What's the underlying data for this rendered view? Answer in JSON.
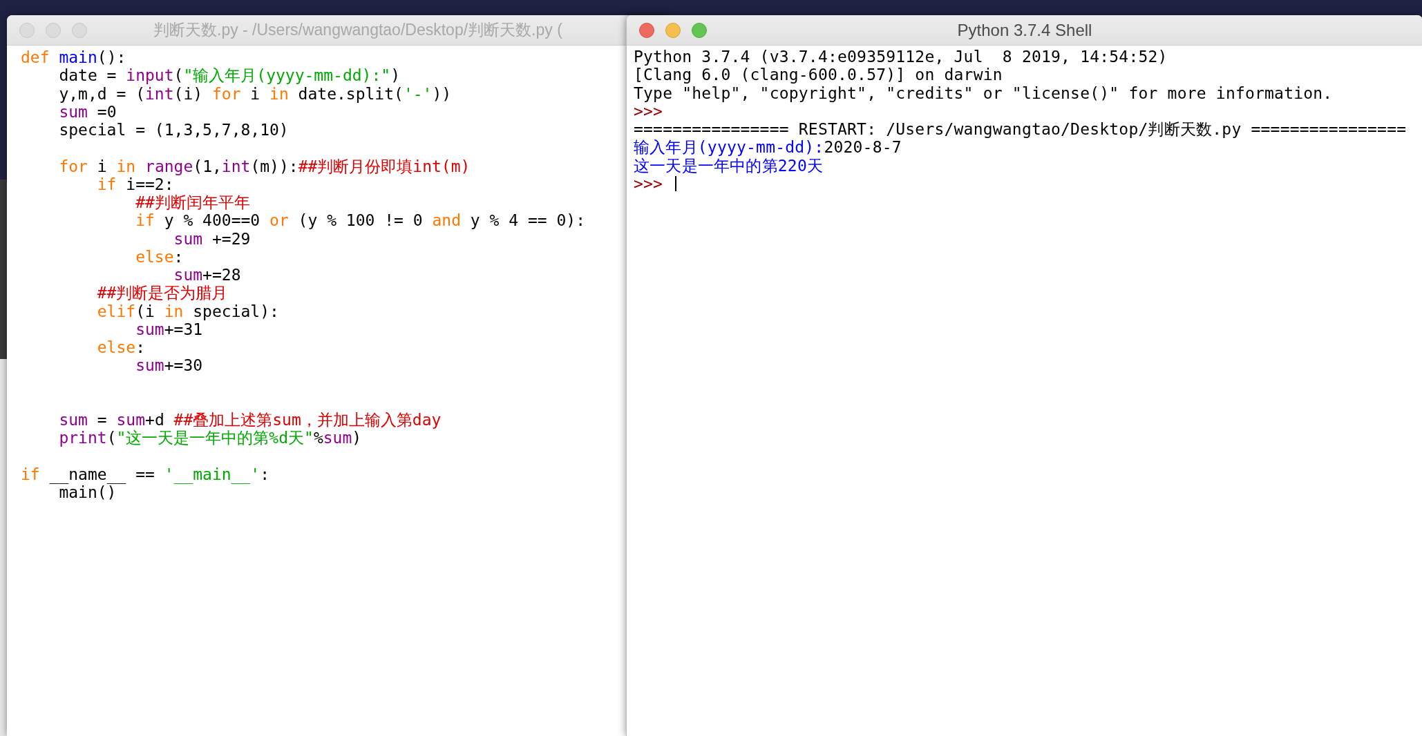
{
  "editor_window": {
    "title": "判断天数.py - /Users/wangwangtao/Desktop/判断天数.py (",
    "lines": [
      {
        "kind": "code",
        "segments": [
          {
            "kind": "keyword",
            "text": "def"
          },
          {
            "kind": "definition",
            "text": " main"
          },
          {
            "kind": "plain",
            "text": "():"
          }
        ]
      },
      {
        "kind": "code",
        "segments": [
          {
            "kind": "plain",
            "text": "    date = "
          },
          {
            "kind": "builtin",
            "text": "input"
          },
          {
            "kind": "plain",
            "text": "("
          },
          {
            "kind": "string",
            "text": "\"输入年月(yyyy-mm-dd):\""
          },
          {
            "kind": "plain",
            "text": ")"
          }
        ]
      },
      {
        "kind": "code",
        "segments": [
          {
            "kind": "plain",
            "text": "    y,m,d = ("
          },
          {
            "kind": "builtin",
            "text": "int"
          },
          {
            "kind": "plain",
            "text": "(i) "
          },
          {
            "kind": "keyword",
            "text": "for"
          },
          {
            "kind": "plain",
            "text": " i "
          },
          {
            "kind": "keyword",
            "text": "in"
          },
          {
            "kind": "plain",
            "text": " date.split("
          },
          {
            "kind": "string",
            "text": "'-'"
          },
          {
            "kind": "plain",
            "text": "))"
          }
        ]
      },
      {
        "kind": "code",
        "segments": [
          {
            "kind": "builtin",
            "text": "    sum"
          },
          {
            "kind": "plain",
            "text": " =0"
          }
        ]
      },
      {
        "kind": "code",
        "segments": [
          {
            "kind": "plain",
            "text": "    special = (1,3,5,7,8,10)"
          }
        ]
      },
      {
        "kind": "blank"
      },
      {
        "kind": "code",
        "segments": [
          {
            "kind": "keyword",
            "text": "    for"
          },
          {
            "kind": "plain",
            "text": " i "
          },
          {
            "kind": "keyword",
            "text": "in"
          },
          {
            "kind": "builtin",
            "text": " range"
          },
          {
            "kind": "plain",
            "text": "(1,"
          },
          {
            "kind": "builtin",
            "text": "int"
          },
          {
            "kind": "plain",
            "text": "(m)):"
          },
          {
            "kind": "comment",
            "text": "##判断月份即填int(m)"
          }
        ]
      },
      {
        "kind": "code",
        "segments": [
          {
            "kind": "keyword",
            "text": "        if"
          },
          {
            "kind": "plain",
            "text": " i==2:"
          }
        ]
      },
      {
        "kind": "code",
        "segments": [
          {
            "kind": "comment",
            "text": "            ##判断闰年平年"
          }
        ]
      },
      {
        "kind": "code",
        "segments": [
          {
            "kind": "keyword",
            "text": "            if"
          },
          {
            "kind": "plain",
            "text": " y % 400==0 "
          },
          {
            "kind": "keyword",
            "text": "or"
          },
          {
            "kind": "plain",
            "text": " (y % 100 != 0 "
          },
          {
            "kind": "keyword",
            "text": "and"
          },
          {
            "kind": "plain",
            "text": " y % 4 == 0):"
          }
        ]
      },
      {
        "kind": "code",
        "segments": [
          {
            "kind": "builtin",
            "text": "                sum"
          },
          {
            "kind": "plain",
            "text": " +=29"
          }
        ]
      },
      {
        "kind": "code",
        "segments": [
          {
            "kind": "keyword",
            "text": "            else"
          },
          {
            "kind": "plain",
            "text": ":"
          }
        ]
      },
      {
        "kind": "code",
        "segments": [
          {
            "kind": "builtin",
            "text": "                sum"
          },
          {
            "kind": "plain",
            "text": "+=28"
          }
        ]
      },
      {
        "kind": "code",
        "segments": [
          {
            "kind": "comment",
            "text": "        ##判断是否为腊月"
          }
        ]
      },
      {
        "kind": "code",
        "segments": [
          {
            "kind": "keyword",
            "text": "        elif"
          },
          {
            "kind": "plain",
            "text": "(i "
          },
          {
            "kind": "keyword",
            "text": "in"
          },
          {
            "kind": "plain",
            "text": " special):"
          }
        ]
      },
      {
        "kind": "code",
        "segments": [
          {
            "kind": "builtin",
            "text": "            sum"
          },
          {
            "kind": "plain",
            "text": "+=31"
          }
        ]
      },
      {
        "kind": "code",
        "segments": [
          {
            "kind": "keyword",
            "text": "        else"
          },
          {
            "kind": "plain",
            "text": ":"
          }
        ]
      },
      {
        "kind": "code",
        "segments": [
          {
            "kind": "builtin",
            "text": "            sum"
          },
          {
            "kind": "plain",
            "text": "+=30"
          }
        ]
      },
      {
        "kind": "blank"
      },
      {
        "kind": "blank"
      },
      {
        "kind": "code",
        "segments": [
          {
            "kind": "builtin",
            "text": "    sum"
          },
          {
            "kind": "plain",
            "text": " = "
          },
          {
            "kind": "builtin",
            "text": "sum"
          },
          {
            "kind": "plain",
            "text": "+d "
          },
          {
            "kind": "comment",
            "text": "##叠加上述第sum，并加上输入第day"
          }
        ]
      },
      {
        "kind": "code",
        "segments": [
          {
            "kind": "builtin",
            "text": "    print"
          },
          {
            "kind": "plain",
            "text": "("
          },
          {
            "kind": "string",
            "text": "\"这一天是一年中的第%d天\""
          },
          {
            "kind": "plain",
            "text": "%"
          },
          {
            "kind": "builtin",
            "text": "sum"
          },
          {
            "kind": "plain",
            "text": ")"
          }
        ]
      },
      {
        "kind": "blank"
      },
      {
        "kind": "code",
        "segments": [
          {
            "kind": "keyword",
            "text": "if"
          },
          {
            "kind": "plain",
            "text": " __name__ == "
          },
          {
            "kind": "string",
            "text": "'__main__'"
          },
          {
            "kind": "plain",
            "text": ":"
          }
        ]
      },
      {
        "kind": "code",
        "segments": [
          {
            "kind": "plain",
            "text": "    main()"
          }
        ]
      }
    ]
  },
  "shell_window": {
    "title": "Python 3.7.4 Shell",
    "lines": [
      {
        "segments": [
          {
            "kind": "plain",
            "text": "Python 3.7.4 (v3.7.4:e09359112e, Jul  8 2019, 14:54:52)"
          }
        ]
      },
      {
        "segments": [
          {
            "kind": "plain",
            "text": "[Clang 6.0 (clang-600.0.57)] on darwin"
          }
        ]
      },
      {
        "segments": [
          {
            "kind": "plain",
            "text": "Type \"help\", \"copyright\", \"credits\" or \"license()\" for more information."
          }
        ]
      },
      {
        "segments": [
          {
            "kind": "prompt",
            "text": ">>>"
          }
        ]
      },
      {
        "segments": [
          {
            "kind": "plain",
            "text": "================ RESTART: /Users/wangwangtao/Desktop/判断天数.py ================"
          }
        ]
      },
      {
        "segments": [
          {
            "kind": "stdout",
            "text": "输入年月(yyyy-mm-dd):"
          },
          {
            "kind": "plain",
            "text": "2020-8-7"
          }
        ]
      },
      {
        "segments": [
          {
            "kind": "stdout",
            "text": "这一天是一年中的第220天"
          }
        ]
      },
      {
        "segments": [
          {
            "kind": "prompt",
            "text": ">>> "
          }
        ],
        "cursor": true
      }
    ]
  }
}
